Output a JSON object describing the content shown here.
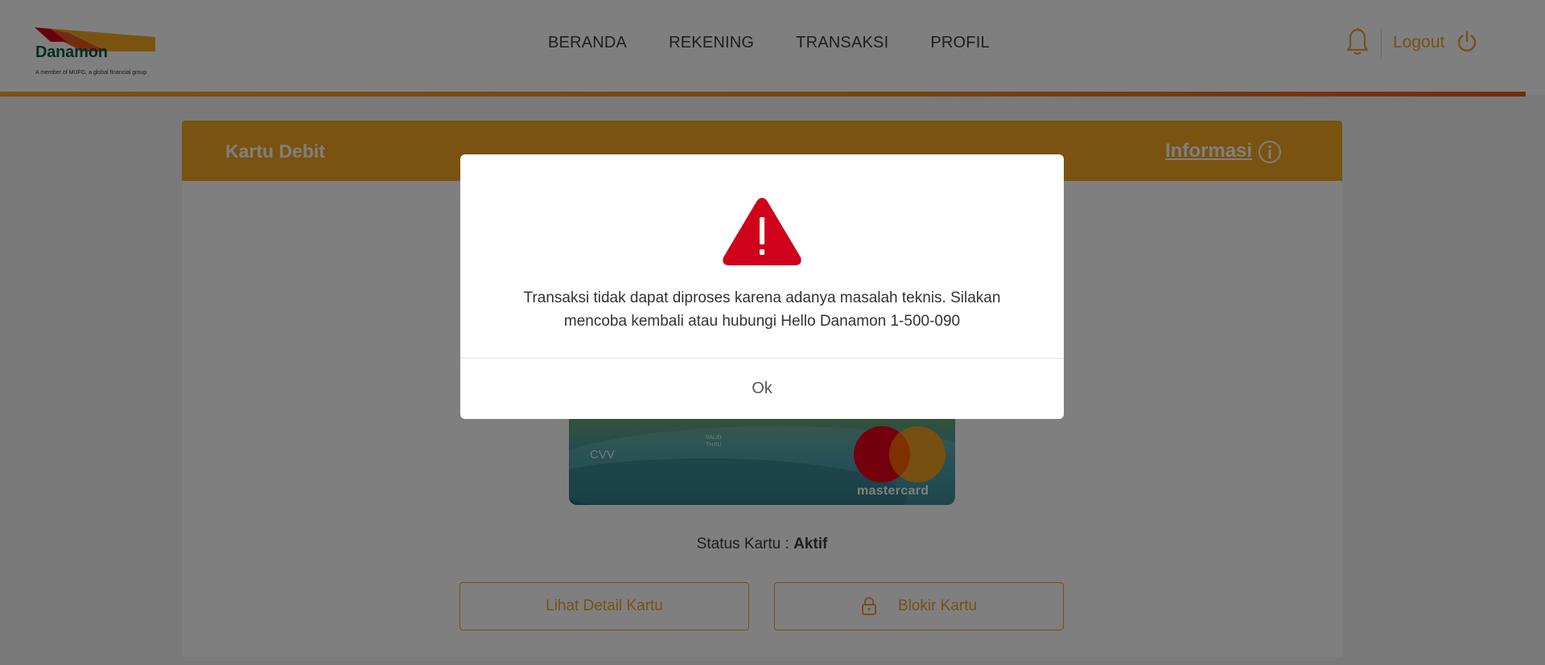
{
  "header": {
    "logo": {
      "name": "Danamon",
      "tagline": "A member of MUFG, a global financial group"
    },
    "nav": [
      {
        "label": "BERANDA"
      },
      {
        "label": "REKENING"
      },
      {
        "label": "TRANSAKSI"
      },
      {
        "label": "PROFIL"
      }
    ],
    "notification_icon": "bell-icon",
    "logout_label": "Logout",
    "logout_icon": "power-icon"
  },
  "panel": {
    "title": "Kartu Debit",
    "info_label": "Informasi",
    "info_icon": "info-icon",
    "card": {
      "cvv_label": "CVV",
      "valid_label_1": "VALID",
      "valid_label_2": "THRU",
      "network": "mastercard"
    },
    "status_label": "Status Kartu : ",
    "status_value": "Aktif",
    "detail_button": "Lihat Detail Kartu",
    "block_button": "Blokir Kartu",
    "block_icon": "lock-icon"
  },
  "modal": {
    "icon": "warning-icon",
    "message": "Transaksi tidak dapat diproses karena adanya masalah teknis. Silakan mencoba kembali atau hubungi Hello Danamon 1-500-090",
    "ok_label": "Ok"
  },
  "colors": {
    "accent": "#f5a623",
    "brand_green": "#0d5a3f",
    "warning_red": "#d0021b"
  }
}
